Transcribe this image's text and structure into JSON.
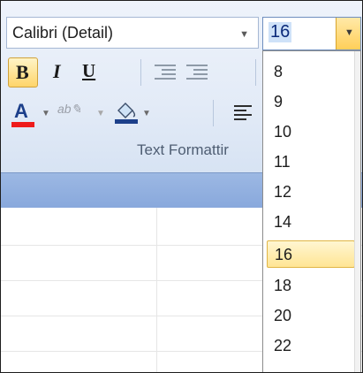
{
  "font_name": {
    "value": "Calibri (Detail)"
  },
  "font_size": {
    "value": "16"
  },
  "toolbar": {
    "bold_label": "B",
    "italic_label": "I",
    "underline_label": "U",
    "font_color_label": "A",
    "highlight_label": "ab"
  },
  "group_label": "Text Formattir",
  "size_options": [
    "8",
    "9",
    "10",
    "11",
    "12",
    "14",
    "16",
    "18",
    "20",
    "22"
  ],
  "selected_size": "16",
  "colors": {
    "accent": "#ffd56a",
    "font_color_bar": "#ee1b1b",
    "header_strip": "#9cb8e3"
  }
}
